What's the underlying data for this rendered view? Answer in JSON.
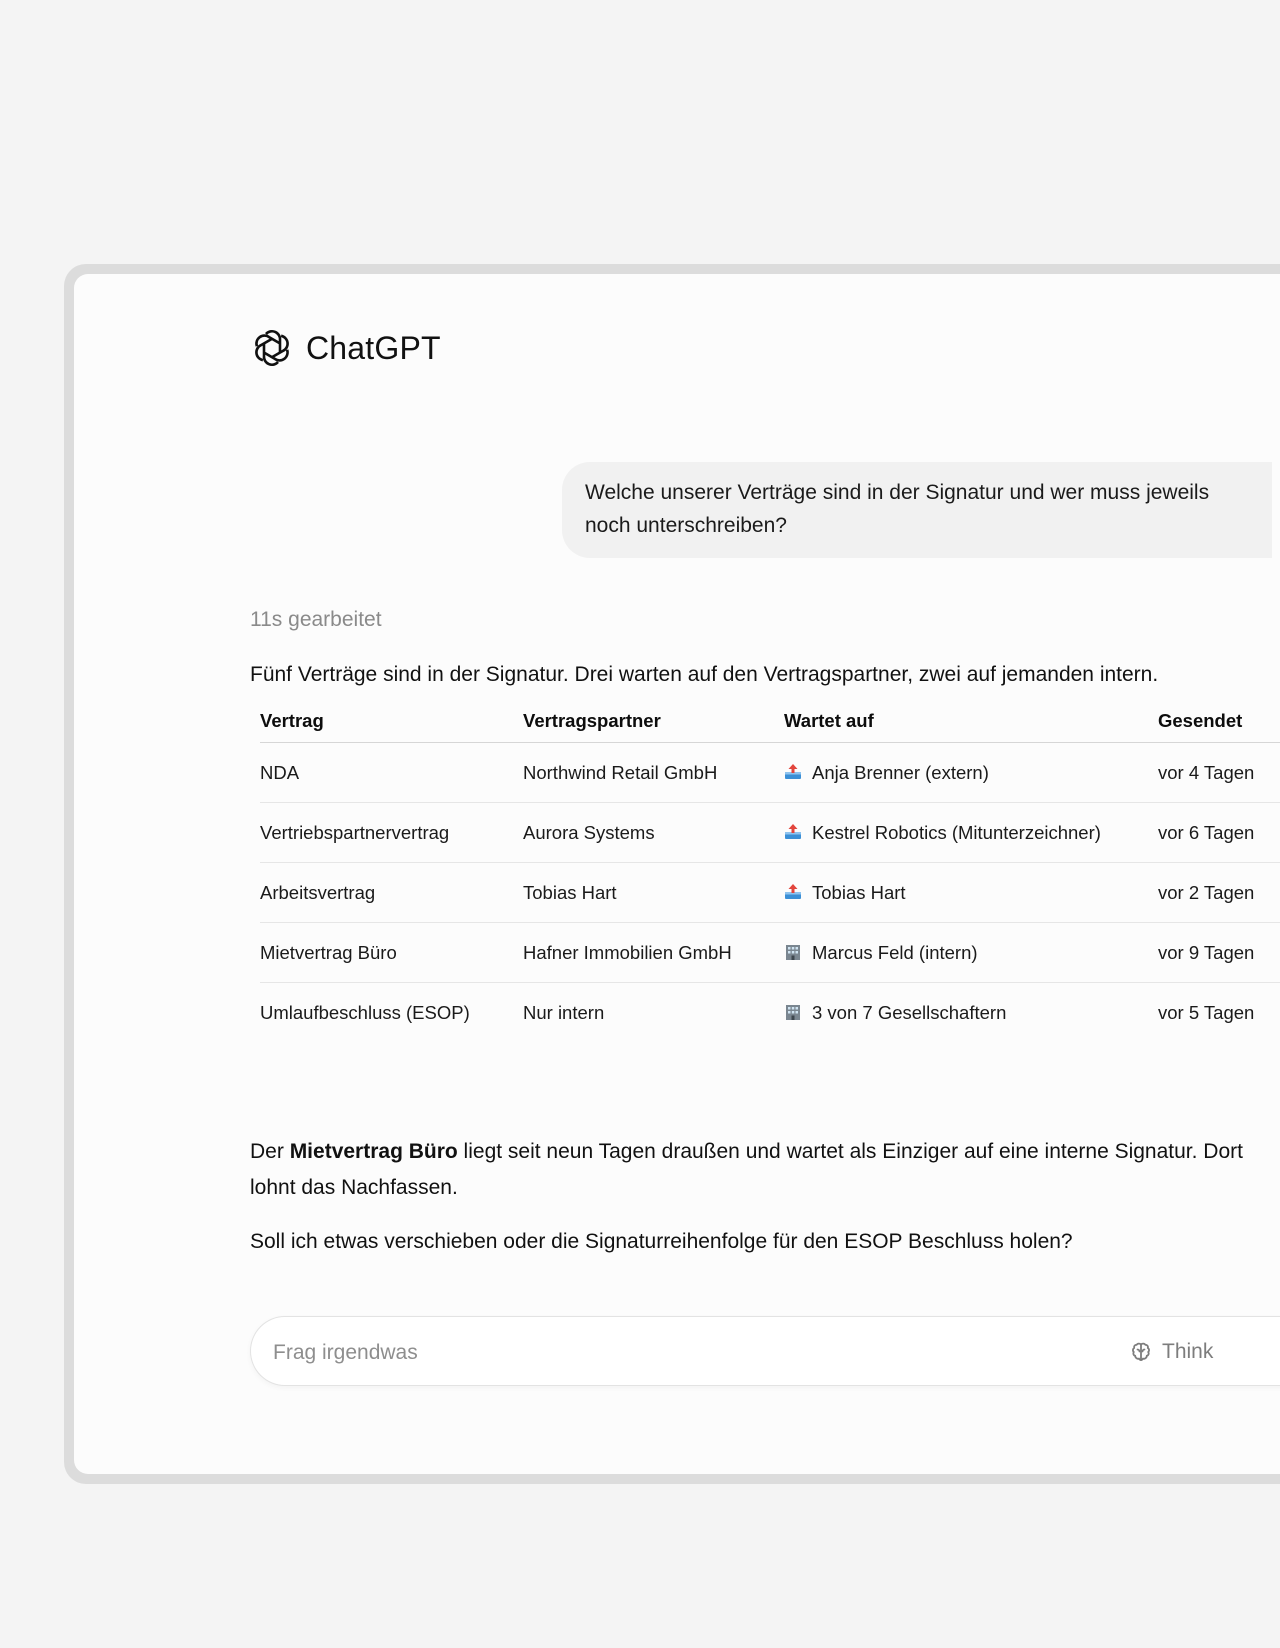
{
  "app": {
    "name": "ChatGPT",
    "logo_icon": "openai-logo-icon"
  },
  "conversation": {
    "user_message": "Welche unserer Verträge sind in der Signatur und wer muss jeweils noch unterschreiben?",
    "thinking_label": "11s gearbeitet",
    "intro": "Fünf Verträge sind in der Signatur. Drei warten auf den Vertragspartner, zwei auf jemanden intern.",
    "table": {
      "headers": [
        "Vertrag",
        "Vertragspartner",
        "Wartet auf",
        "Gesendet"
      ],
      "rows": [
        {
          "contract": "NDA",
          "partner": "Northwind Retail GmbH",
          "icon": "outbox-tray-icon",
          "waiting": "Anja Brenner (extern)",
          "sent": "vor 4 Tagen"
        },
        {
          "contract": "Vertriebspartnervertrag",
          "partner": "Aurora Systems",
          "icon": "outbox-tray-icon",
          "waiting": "Kestrel Robotics (Mitunterzeichner)",
          "sent": "vor 6 Tagen"
        },
        {
          "contract": "Arbeitsvertrag",
          "partner": "Tobias Hart",
          "icon": "outbox-tray-icon",
          "waiting": "Tobias Hart",
          "sent": "vor 2 Tagen"
        },
        {
          "contract": "Mietvertrag Büro",
          "partner": "Hafner Immobilien GmbH",
          "icon": "office-building-icon",
          "waiting": "Marcus Feld (intern)",
          "sent": "vor 9 Tagen"
        },
        {
          "contract": "Umlaufbeschluss (ESOP)",
          "partner": "Nur intern",
          "icon": "office-building-icon",
          "waiting": "3 von 7 Gesellschaftern",
          "sent": "vor 5 Tagen"
        }
      ]
    },
    "closing": {
      "prefix": "Der ",
      "bold": "Mietvertrag Büro",
      "suffix": " liegt seit neun Tagen draußen und wartet als Einziger auf eine interne Signatur. Dort lohnt das Nachfassen."
    },
    "question": "Soll ich etwas verschieben oder die Signaturreihenfolge für den ESOP Beschluss holen?"
  },
  "composer": {
    "placeholder": "Frag irgendwas",
    "think_label": "Think",
    "think_icon": "brain-icon"
  },
  "colors": {
    "page_bg": "#f4f4f4",
    "frame": "#dcdcdc",
    "window_bg": "#fcfcfc",
    "user_bubble": "#f1f1f1",
    "muted_text": "#8a8a8a"
  }
}
